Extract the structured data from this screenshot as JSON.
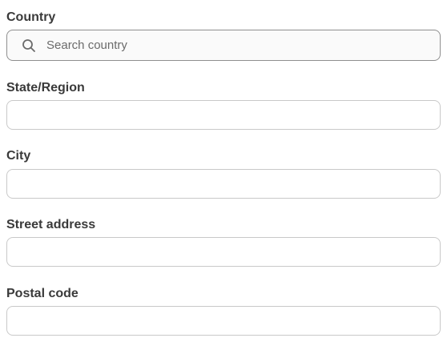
{
  "fields": {
    "country": {
      "label": "Country",
      "placeholder": "Search country",
      "value": ""
    },
    "state": {
      "label": "State/Region",
      "value": ""
    },
    "city": {
      "label": "City",
      "value": ""
    },
    "street": {
      "label": "Street address",
      "value": ""
    },
    "postal": {
      "label": "Postal code",
      "value": ""
    }
  },
  "icons": {
    "country_search": "search-icon"
  },
  "colors": {
    "label_text": "#3a3a3a",
    "input_border": "#c9c9c9",
    "search_border": "#8f8f8f",
    "search_background": "#fafafa",
    "placeholder_text": "#6b6b6b"
  }
}
